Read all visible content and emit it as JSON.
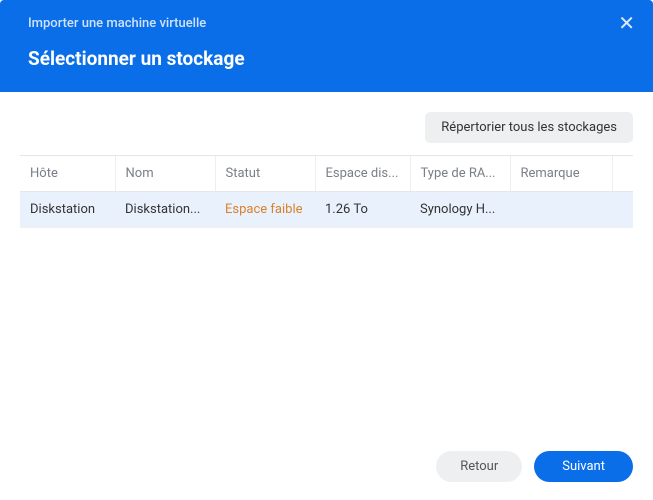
{
  "header": {
    "breadcrumb": "Importer une machine virtuelle",
    "title": "Sélectionner un stockage"
  },
  "toolbar": {
    "list_all_label": "Répertorier tous les stockages"
  },
  "table": {
    "columns": {
      "host": "Hôte",
      "name": "Nom",
      "status": "Statut",
      "space": "Espace dis...",
      "raid": "Type de RA...",
      "remark": "Remarque"
    },
    "rows": [
      {
        "host": "Diskstation",
        "name": "Diskstation...",
        "status": "Espace faible",
        "status_class": "low",
        "space": "1.26 To",
        "raid": "Synology H...",
        "remark": ""
      }
    ]
  },
  "footer": {
    "back_label": "Retour",
    "next_label": "Suivant"
  },
  "colors": {
    "primary": "#0a6ee8",
    "warning": "#d9822b"
  }
}
